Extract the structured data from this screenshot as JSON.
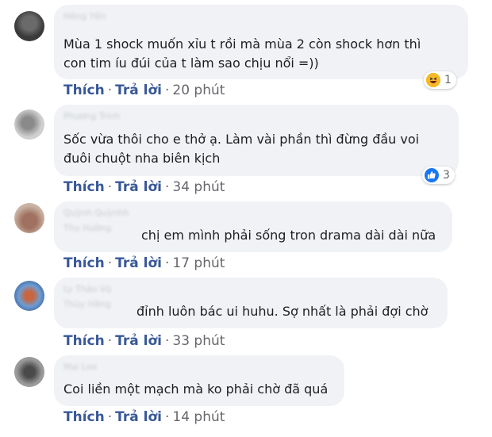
{
  "comments": [
    {
      "author": "Hồng Yến",
      "author_line2": "",
      "text_lines": [
        "Mùa 1 shock muốn xỉu t rồi mà mùa 2 còn shock hơn thì",
        "con tim íu đúi của t làm sao chịu nổi =))"
      ],
      "like": "Thích",
      "reply": "Trả lời",
      "time": "20 phút",
      "reaction": {
        "icon": "haha-emoji-icon",
        "count": "1"
      }
    },
    {
      "author": "Phương Trinh",
      "author_line2": "",
      "text_lines": [
        "Sốc vừa thôi cho e thở ạ. Làm vài phần thì đừng đầu voi",
        "đuôi chuột nha biên kịch"
      ],
      "like": "Thích",
      "reply": "Trả lời",
      "time": "34 phút",
      "reaction": {
        "icon": "like-thumb-icon",
        "count": "3"
      }
    },
    {
      "author": "Quỳnh Quỳnhh",
      "author_line2": "Thu Hường",
      "text_lines": [
        "chị em mình phải sống tron drama dài dài nữa"
      ],
      "like": "Thích",
      "reply": "Trả lời",
      "time": "17 phút"
    },
    {
      "author": "Ly Thảo Vũ",
      "author_line2": "Thùy Hằng",
      "text_lines": [
        "đỉnh luôn bác ui huhu. Sợ nhất là phải đợi chờ"
      ],
      "like": "Thích",
      "reply": "Trả lời",
      "time": "33 phút"
    },
    {
      "author": "Mai Lee",
      "author_line2": "",
      "text_lines": [
        "Coi liền một mạch mà ko phải chờ đã quá"
      ],
      "like": "Thích",
      "reply": "Trả lời",
      "time": "14 phút"
    }
  ],
  "colors": {
    "bubble": "#f0f2f5",
    "action": "#385898",
    "meta": "#65676b",
    "like_blue": "#1877f2",
    "haha_yellow": "#f7b928"
  }
}
